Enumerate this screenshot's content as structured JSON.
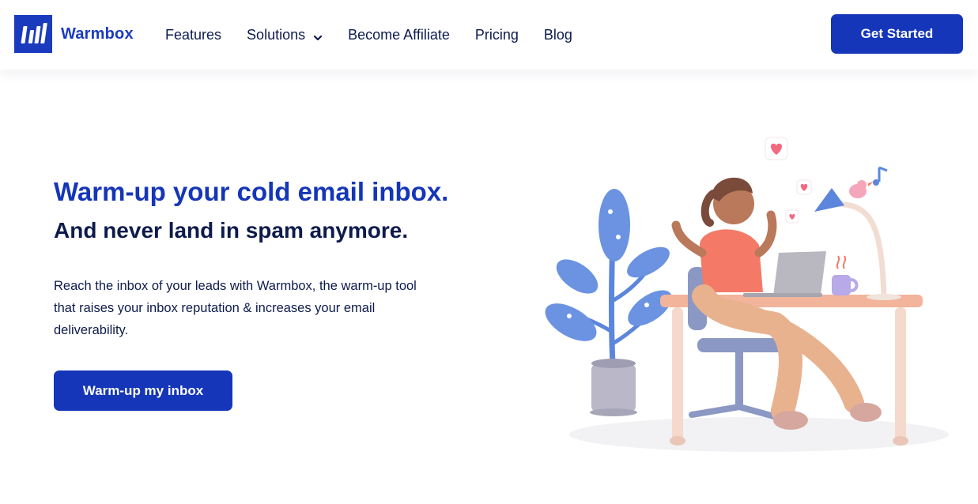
{
  "brand": {
    "name": "Warmbox",
    "accent": "#1536b8",
    "dark": "#0d1b4c"
  },
  "nav": {
    "items": [
      {
        "label": "Features"
      },
      {
        "label": "Solutions",
        "icon": "chevron-down-icon"
      },
      {
        "label": "Become Affiliate"
      },
      {
        "label": "Pricing"
      },
      {
        "label": "Blog"
      }
    ],
    "cta_label": "Get Started"
  },
  "hero": {
    "title": "Warm-up your cold email inbox.",
    "subtitle": "And never land in spam anymore.",
    "description": "Reach the inbox of your leads with Warmbox, the warm-up tool that raises your inbox reputation & increases your email deliverability.",
    "cta_label": "Warm-up my inbox"
  }
}
